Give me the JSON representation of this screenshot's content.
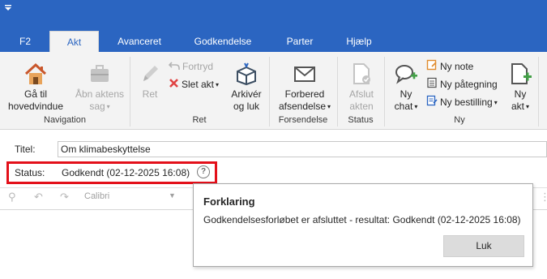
{
  "colors": {
    "brand": "#2b65c1",
    "highlight": "#e3101a",
    "ribbon_bg": "#f3f3f3",
    "green_plus": "#43a047",
    "red_x": "#e04343"
  },
  "tabs": [
    "F2",
    "Akt",
    "Avanceret",
    "Godkendelse",
    "Parter",
    "Hjælp"
  ],
  "active_tab": "Akt",
  "ribbon": {
    "navigation": {
      "label": "Navigation",
      "goto_home": [
        "Gå til",
        "hovedvindue"
      ],
      "open_case": [
        "Åbn aktens",
        "sag"
      ]
    },
    "ret": {
      "label": "Ret",
      "edit": "Ret",
      "undo": "Fortryd",
      "delete": "Slet akt",
      "archive": [
        "Arkivér",
        "og luk"
      ]
    },
    "forsendelse": {
      "label": "Forsendelse",
      "prepare": [
        "Forbered",
        "afsendelse"
      ]
    },
    "status": {
      "label": "Status",
      "complete": [
        "Afslut",
        "akten"
      ]
    },
    "ny": {
      "label": "Ny",
      "chat": [
        "Ny",
        "chat"
      ],
      "note": "Ny note",
      "reminder": "Ny påtegning",
      "order": "Ny bestilling",
      "new_act": [
        "Ny",
        "akt"
      ]
    }
  },
  "icons": {
    "home": "home-icon",
    "open_case": "briefcase-icon",
    "edit": "pencil-icon",
    "undo": "undo-icon",
    "delete": "x-icon",
    "archive": "archive-box-icon",
    "prepare": "envelope-icon",
    "complete": "document-check-icon",
    "chat": "chat-plus-icon",
    "note": "note-icon",
    "reminder": "list-document-icon",
    "order": "order-icon",
    "new_act": "new-document-icon"
  },
  "form": {
    "title_label": "Titel:",
    "title_value": "Om klimabeskyttelse",
    "status_label": "Status:",
    "status_value": "Godkendt (02-12-2025 16:08)",
    "help": "?"
  },
  "editor": {
    "font": "Calibri"
  },
  "popup": {
    "title": "Forklaring",
    "text": "Godkendelsesforløbet er afsluttet - resultat: Godkendt (02-12-2025 16:08)",
    "close": "Luk"
  }
}
